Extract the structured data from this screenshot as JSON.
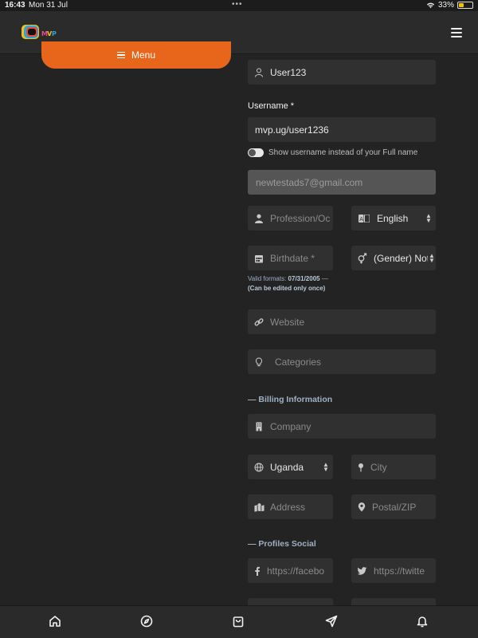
{
  "status": {
    "time": "16:43",
    "date": "Mon 31 Jul",
    "battery": "33%",
    "battery_level": 0.33
  },
  "header": {
    "logo_text": "MVP",
    "menu_icon": "hamburger-icon"
  },
  "sidebar": {
    "menu_label": "Menu"
  },
  "form": {
    "display_name": "User123",
    "username_label": "Username *",
    "username_value": "mvp.ug/user1236",
    "show_username_label": "Show username instead of your Full name",
    "email": "newtestads7@gmail.com",
    "profession_placeholder": "Profession/Oc",
    "language": "English",
    "birthdate_placeholder": "Birthdate *",
    "gender": "(Gender) Not.",
    "hint_prefix": "Valid formats: ",
    "hint_date": "07/31/2005",
    "hint_dash": " —",
    "hint_note": "(Can be edited only once)",
    "website_placeholder": "Website",
    "categories_placeholder": "Categories",
    "billing_title": "— Billing Information",
    "company_placeholder": "Company",
    "country": "Uganda",
    "city_placeholder": "City",
    "address_placeholder": "Address",
    "postal_placeholder": "Postal/ZIP",
    "social_title": "— Profiles Social",
    "facebook_placeholder": "https://facebo",
    "twitter_placeholder": "https://twitte"
  },
  "bottom_nav": [
    "home-icon",
    "compass-icon",
    "shopping-bag-icon",
    "send-icon",
    "bell-icon"
  ],
  "colors": {
    "accent": "#e8661b",
    "background": "#232323",
    "field": "#303030",
    "section": "#9fb0c2"
  }
}
